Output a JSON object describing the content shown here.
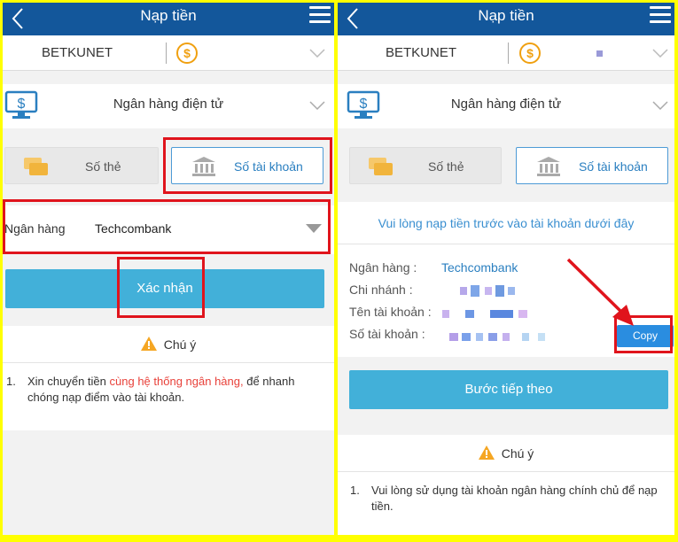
{
  "left": {
    "header_title": "Nạp tiền",
    "account_name": "BETKUNET",
    "coin_symbol": "$",
    "method_label": "Ngân hàng điện tử",
    "tabs": {
      "card_label": "Số thẻ",
      "account_label": "Số tài khoản"
    },
    "bank_field": {
      "label": "Ngân hàng",
      "value": "Techcombank"
    },
    "confirm_label": "Xác nhận",
    "note_title": "Chú ý",
    "note": {
      "num": "1.",
      "pre": "Xin chuyển tiền ",
      "highlight": "cùng hệ thống ngân hàng,",
      "post": " để nhanh chóng nạp điểm vào tài khoản."
    }
  },
  "right": {
    "header_title": "Nạp tiền",
    "account_name": "BETKUNET",
    "coin_symbol": "$",
    "method_label": "Ngân hàng điện tử",
    "tabs": {
      "card_label": "Số thẻ",
      "account_label": "Số tài khoản"
    },
    "info_heading": "Vui lòng nạp tiền trước vào tài khoản dưới đây",
    "rows": [
      {
        "key": "Ngân hàng :",
        "value": "Techcombank"
      },
      {
        "key": "Chi nhánh :",
        "value": ""
      },
      {
        "key": "Tên tài khoản :",
        "value": ""
      },
      {
        "key": "Số tài khoản :",
        "value": ""
      }
    ],
    "copy_label": "Copy",
    "next_label": "Bước tiếp theo",
    "note_title": "Chú ý",
    "note": {
      "num": "1.",
      "text": "Vui lòng sử dụng tài khoản ngân hàng chính chủ để nạp tiền."
    }
  },
  "colors": {
    "header": "#13579b",
    "primary": "#42b0d9",
    "highlight": "#e0141c",
    "frame": "#ffff00"
  },
  "icons": [
    "back-icon",
    "menu-icon",
    "coin-icon",
    "chevron-down-icon",
    "monitor-dollar-icon",
    "card-icon",
    "bank-icon",
    "dropdown-triangle-icon",
    "warning-icon",
    "red-arrow-icon"
  ]
}
